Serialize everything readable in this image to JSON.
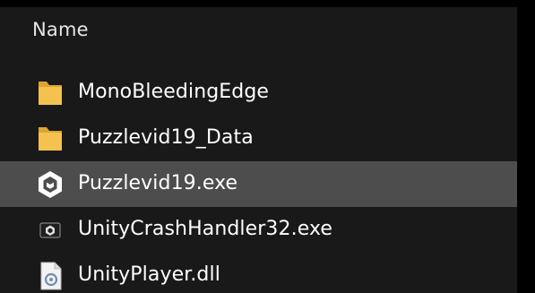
{
  "header": {
    "name_label": "Name"
  },
  "files": [
    {
      "name": "MonoBleedingEdge",
      "icon": "folder-icon",
      "selected": false
    },
    {
      "name": "Puzzlevid19_Data",
      "icon": "folder-icon",
      "selected": false
    },
    {
      "name": "Puzzlevid19.exe",
      "icon": "unity-app-icon",
      "selected": true
    },
    {
      "name": "UnityCrashHandler32.exe",
      "icon": "crash-handler-icon",
      "selected": false
    },
    {
      "name": "UnityPlayer.dll",
      "icon": "dll-file-icon",
      "selected": false
    }
  ],
  "colors": {
    "background": "#191919",
    "selection": "#4d4d4d",
    "folder": "#f4c24f",
    "text": "#ffffff"
  }
}
